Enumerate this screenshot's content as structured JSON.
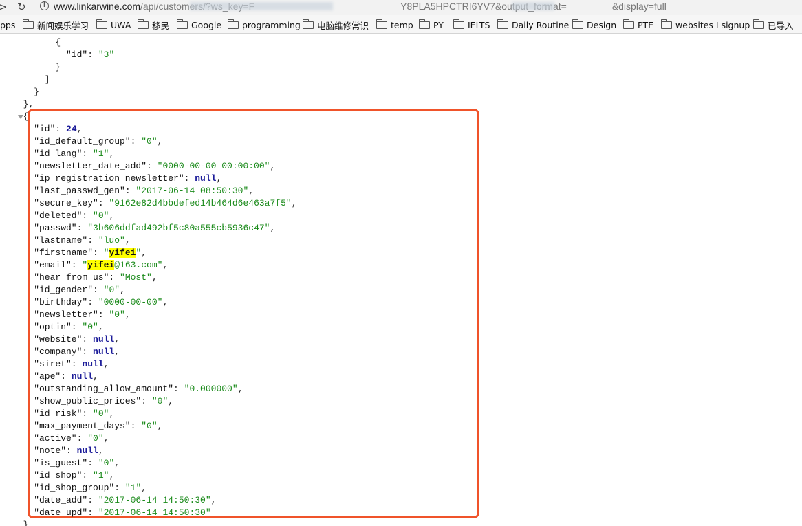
{
  "browser": {
    "url_host": "www.linkarwine.com",
    "url_path_start": "/api/customers/?ws_key=F",
    "url_path_mid": "Y8PLA5HPCTRI6YV7&output_format=",
    "url_path_end": "&display=full"
  },
  "bookmarks": [
    {
      "label": "pps",
      "folder": false
    },
    {
      "label": "新闻娱乐学习",
      "folder": true
    },
    {
      "label": "UWA",
      "folder": true
    },
    {
      "label": "移民",
      "folder": true
    },
    {
      "label": "Google",
      "folder": true
    },
    {
      "label": "programming",
      "folder": true
    },
    {
      "label": "电脑维修常识",
      "folder": true
    },
    {
      "label": "temp",
      "folder": true
    },
    {
      "label": "PY",
      "folder": true
    },
    {
      "label": "IELTS",
      "folder": true
    },
    {
      "label": "Daily Routine",
      "folder": true
    },
    {
      "label": "Design",
      "folder": true
    },
    {
      "label": "PTE",
      "folder": true
    },
    {
      "label": "websites I signup",
      "folder": true
    },
    {
      "label": "已导入",
      "folder": true
    }
  ],
  "json_prefix": [
    {
      "indent": 8,
      "text": "{"
    },
    {
      "indent": 10,
      "key": "id",
      "value": "3",
      "type": "string",
      "comma": false
    },
    {
      "indent": 8,
      "text": "}"
    },
    {
      "indent": 6,
      "text": "]"
    },
    {
      "indent": 4,
      "text": "}"
    },
    {
      "indent": 2,
      "text": "},"
    },
    {
      "indent": 2,
      "text": "{"
    }
  ],
  "customer_fields": [
    {
      "key": "id",
      "value": "24",
      "type": "number"
    },
    {
      "key": "id_default_group",
      "value": "0",
      "type": "string"
    },
    {
      "key": "id_lang",
      "value": "1",
      "type": "string"
    },
    {
      "key": "newsletter_date_add",
      "value": "0000-00-00 00:00:00",
      "type": "string"
    },
    {
      "key": "ip_registration_newsletter",
      "value": "null",
      "type": "null"
    },
    {
      "key": "last_passwd_gen",
      "value": "2017-06-14 08:50:30",
      "type": "string"
    },
    {
      "key": "secure_key",
      "value": "9162e82d4bbdefed14b464d6e463a7f5",
      "type": "string"
    },
    {
      "key": "deleted",
      "value": "0",
      "type": "string"
    },
    {
      "key": "passwd",
      "value": "3b606ddfad492bf5c80a555cb5936c47",
      "type": "string"
    },
    {
      "key": "lastname",
      "value": "luo",
      "type": "string"
    },
    {
      "key": "firstname",
      "value": "yifei",
      "type": "string",
      "highlight": "yifei"
    },
    {
      "key": "email",
      "value": "yifei@163.com",
      "type": "string",
      "highlight": "yifei"
    },
    {
      "key": "hear_from_us",
      "value": "Most",
      "type": "string"
    },
    {
      "key": "id_gender",
      "value": "0",
      "type": "string"
    },
    {
      "key": "birthday",
      "value": "0000-00-00",
      "type": "string"
    },
    {
      "key": "newsletter",
      "value": "0",
      "type": "string"
    },
    {
      "key": "optin",
      "value": "0",
      "type": "string"
    },
    {
      "key": "website",
      "value": "null",
      "type": "null"
    },
    {
      "key": "company",
      "value": "null",
      "type": "null"
    },
    {
      "key": "siret",
      "value": "null",
      "type": "null"
    },
    {
      "key": "ape",
      "value": "null",
      "type": "null"
    },
    {
      "key": "outstanding_allow_amount",
      "value": "0.000000",
      "type": "string"
    },
    {
      "key": "show_public_prices",
      "value": "0",
      "type": "string"
    },
    {
      "key": "id_risk",
      "value": "0",
      "type": "string"
    },
    {
      "key": "max_payment_days",
      "value": "0",
      "type": "string"
    },
    {
      "key": "active",
      "value": "0",
      "type": "string"
    },
    {
      "key": "note",
      "value": "null",
      "type": "null"
    },
    {
      "key": "is_guest",
      "value": "0",
      "type": "string"
    },
    {
      "key": "id_shop",
      "value": "1",
      "type": "string"
    },
    {
      "key": "id_shop_group",
      "value": "1",
      "type": "string"
    },
    {
      "key": "date_add",
      "value": "2017-06-14 14:50:30",
      "type": "string"
    },
    {
      "key": "date_upd",
      "value": "2017-06-14 14:50:30",
      "type": "string",
      "last": true
    }
  ],
  "json_suffix": [
    {
      "indent": 2,
      "text": "}"
    }
  ],
  "annotation_color": "#f0532a",
  "highlight_color": "#ffff00"
}
